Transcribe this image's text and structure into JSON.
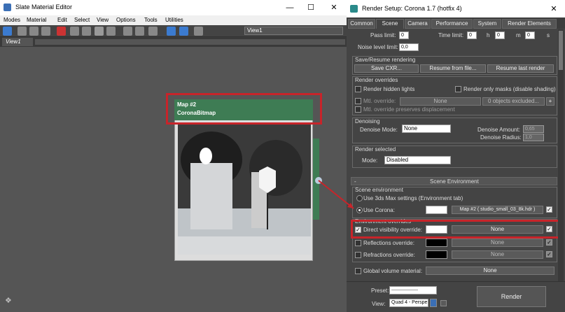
{
  "slate": {
    "title": "Slate Material Editor",
    "menu": [
      "Modes",
      "Material",
      "Edit",
      "Select",
      "View",
      "Options",
      "Tools",
      "Utilities"
    ],
    "view_select": "View1",
    "view_tab": "View1",
    "node": {
      "title": "Map #2",
      "subtitle": "CoronaBitmap"
    }
  },
  "render": {
    "title": "Render Setup: Corona 1.7 (hotfix 4)",
    "tabs": [
      "Common",
      "Scene",
      "Camera",
      "Performance",
      "System",
      "Render Elements"
    ],
    "pass_limit_label": "Pass limit:",
    "pass_limit": "0",
    "time_limit_label": "Time limit:",
    "h": "0",
    "m": "0",
    "s": "0",
    "h_label": "h",
    "m_label": "m",
    "s_label": "s",
    "noise_label": "Noise level limit:",
    "noise": "0,0",
    "save_resume": {
      "title": "Save/Resume rendering",
      "save": "Save CXR...",
      "resume_file": "Resume from file...",
      "resume_last": "Resume last render"
    },
    "overrides": {
      "title": "Render overrides",
      "hidden": "Render hidden lights",
      "masks": "Render only masks (disable shading)",
      "mtl_label": "Mtl. override:",
      "mtl_value": "None",
      "excluded": "0 objects excluded...",
      "plus": "+",
      "preserve": "Mtl. override preserves displacement"
    },
    "denoising": {
      "title": "Denoising",
      "mode_label": "Denoise Mode:",
      "mode": "None",
      "amount_label": "Denoise Amount:",
      "amount": "0,65",
      "radius_label": "Denoise Radius:",
      "radius": "1,0"
    },
    "selected": {
      "title": "Render selected",
      "mode_label": "Mode:",
      "mode": "Disabled"
    },
    "scene_env": {
      "rollout": "Scene Environment",
      "minus": "-",
      "title": "Scene environment",
      "use_max": "Use 3ds Max settings (Environment tab)",
      "use_corona": "Use Corona:",
      "map": "Map #2 ( studio_small_03_8k.hdr )"
    },
    "env_overrides": {
      "title": "Environment overrides",
      "direct": "Direct visibility override:",
      "direct_map": "None",
      "reflections": "Reflections override:",
      "refl_map": "None",
      "refractions": "Refractions override:",
      "refr_map": "None",
      "global_label": "Global volume material:",
      "global_map": "None"
    },
    "bottom": {
      "preset_label": "Preset:",
      "preset": "-------------------",
      "view_label": "View:",
      "view": "Quad 4 - Perspe",
      "render": "Render"
    }
  },
  "colors": {
    "node_green": "#3e7c54",
    "highlight_red": "#c8242a"
  }
}
